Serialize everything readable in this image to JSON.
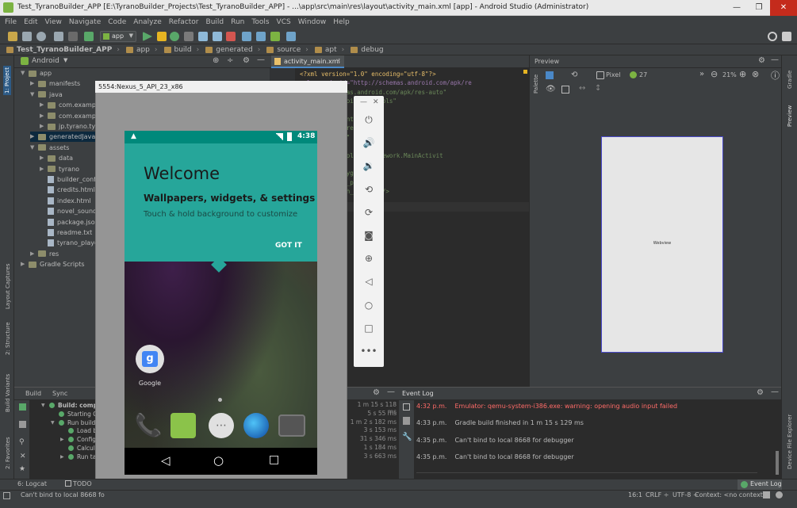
{
  "window": {
    "title": "Test_TyranoBuilder_APP [E:\\TyranoBuilder_Projects\\Test_TyranoBuilder_APP] - ...\\app\\src\\main\\res\\layout\\activity_main.xml [app] - Android Studio (Administrator)",
    "min": "—",
    "max": "❐",
    "close": "✕"
  },
  "menu": [
    "File",
    "Edit",
    "View",
    "Navigate",
    "Code",
    "Analyze",
    "Refactor",
    "Build",
    "Run",
    "Tools",
    "VCS",
    "Window",
    "Help"
  ],
  "toolbar": {
    "config": "app"
  },
  "breadcrumb": [
    "Test_TyranoBuilder_APP",
    "app",
    "build",
    "generated",
    "source",
    "apt",
    "debug"
  ],
  "project": {
    "view": "Android"
  },
  "tree": [
    {
      "label": "app",
      "indent": 0,
      "kind": "folder",
      "arrow": "▼"
    },
    {
      "label": "manifests",
      "indent": 1,
      "kind": "folder",
      "arrow": "▶"
    },
    {
      "label": "java",
      "indent": 1,
      "kind": "folder",
      "arrow": "▼"
    },
    {
      "label": "com.example.",
      "indent": 2,
      "kind": "folder",
      "arrow": "▶"
    },
    {
      "label": "com.example.",
      "indent": 2,
      "kind": "folder",
      "arrow": "▶"
    },
    {
      "label": "jp.tyrano.tyran",
      "indent": 2,
      "kind": "folder",
      "arrow": "▶"
    },
    {
      "label": "generatedJava",
      "indent": 1,
      "kind": "folder",
      "arrow": "▶",
      "selected": true
    },
    {
      "label": "assets",
      "indent": 1,
      "kind": "folder",
      "arrow": "▼"
    },
    {
      "label": "data",
      "indent": 2,
      "kind": "folder",
      "arrow": "▶"
    },
    {
      "label": "tyrano",
      "indent": 2,
      "kind": "folder",
      "arrow": "▶"
    },
    {
      "label": "builder_config",
      "indent": 2,
      "kind": "file",
      "arrow": ""
    },
    {
      "label": "credits.html",
      "indent": 2,
      "kind": "file",
      "arrow": ""
    },
    {
      "label": "index.html",
      "indent": 2,
      "kind": "file",
      "arrow": ""
    },
    {
      "label": "novel_sound.s",
      "indent": 2,
      "kind": "file",
      "arrow": ""
    },
    {
      "label": "package.json",
      "indent": 2,
      "kind": "file",
      "arrow": ""
    },
    {
      "label": "readme.txt",
      "indent": 2,
      "kind": "file",
      "arrow": ""
    },
    {
      "label": "tyrano_player.",
      "indent": 2,
      "kind": "file",
      "arrow": ""
    },
    {
      "label": "res",
      "indent": 1,
      "kind": "folder",
      "arrow": "▶"
    },
    {
      "label": "Gradle Scripts",
      "indent": 0,
      "kind": "folder",
      "arrow": "▶"
    }
  ],
  "editor": {
    "tab": "activity_main.xml",
    "lines": [
      "<?xml version=\"1.0\" encoding=\"utf-8\"?>",
      "xmlns:android=\"http://schemas.android.com/apk/re",
      "\"http://schemas.android.com/apk/res-auto\"",
      "/schemas.android.com/tools\"",
      "ctivity_main\"",
      "h=\"match_parent\"",
      "ght=\"match_parent\"",
      "Windows=\"true\"",
      "=\"vertical\"",
      "tyrano.tyranoplayerframework.MainActivit",
      "",
      "d/webview_playgame\"",
      "_width=\"match_parent\"",
      "_height=\"match_parent\" />",
      "",
      "t>"
    ]
  },
  "preview": {
    "title": "Preview",
    "device": "Pixel",
    "api": "27",
    "zoom": "21%",
    "widget": "Webview"
  },
  "emulator": {
    "title": "5554:Nexus_5_API_23_x86",
    "time": "4:38",
    "welcome": "Welcome",
    "subtitle": "Wallpapers, widgets, & settings",
    "hint": "Touch & hold background to customize",
    "gotit": "GOT IT",
    "google": "Google",
    "controls": [
      "power-icon",
      "volume-up-icon",
      "volume-down-icon",
      "rotate-left-icon",
      "rotate-right-icon",
      "camera-icon",
      "zoom-icon",
      "back-icon",
      "home-icon",
      "overview-icon",
      "more-icon"
    ]
  },
  "build": {
    "tabs": [
      "Build",
      "Sync"
    ],
    "rows": [
      {
        "label": "Build: completed",
        "indent": 0,
        "time": "1 m 15 s 118 ms"
      },
      {
        "label": "Starting Gra",
        "indent": 1,
        "time": "5 s 55 ms"
      },
      {
        "label": "Run build",
        "indent": 1,
        "time": "1 m 2 s 182 ms"
      },
      {
        "label": "Load build",
        "indent": 2,
        "time": "3 s 153 ms"
      },
      {
        "label": "Configu",
        "indent": 2,
        "time": "31 s 346 ms"
      },
      {
        "label": "Calculat",
        "indent": 2,
        "time": "1 s 184 ms"
      },
      {
        "label": "Run task",
        "indent": 2,
        "time": "3 s 663 ms"
      }
    ]
  },
  "eventlog": {
    "title": "Event Log",
    "entries": [
      {
        "time": "4:32 p.m.",
        "msg": "Emulator: qemu-system-i386.exe: warning: opening audio input failed",
        "color": "#ff6b68"
      },
      {
        "time": "4:33 p.m.",
        "msg": "Gradle build finished in 1 m 15 s 129 ms",
        "color": "#bbbbbb"
      },
      {
        "time": "4:35 p.m.",
        "msg": "Can't bind to local 8668 for debugger",
        "color": "#bbbbbb"
      },
      {
        "time": "4:35 p.m.",
        "msg": "Can't bind to local 8668 for debugger",
        "color": "#bbbbbb"
      }
    ]
  },
  "toolwindows": {
    "logcat": "6: Logcat",
    "todo": "TODO",
    "eventlog": "Event Log"
  },
  "status": {
    "message": "Can't bind to local 8668 fo",
    "pos": "16:1",
    "crlf": "CRLF ÷",
    "enc": "UTF-8 ÷",
    "context": "Context: <no context>"
  },
  "sidebars": {
    "project": "1: Project",
    "captures": "Layout Captures",
    "structure": "2: Structure",
    "variants": "Build Variants",
    "favorites": "2: Favorites",
    "gradle": "Gradle",
    "preview": "Preview",
    "device": "Device File Explorer",
    "palette": "Palette"
  }
}
